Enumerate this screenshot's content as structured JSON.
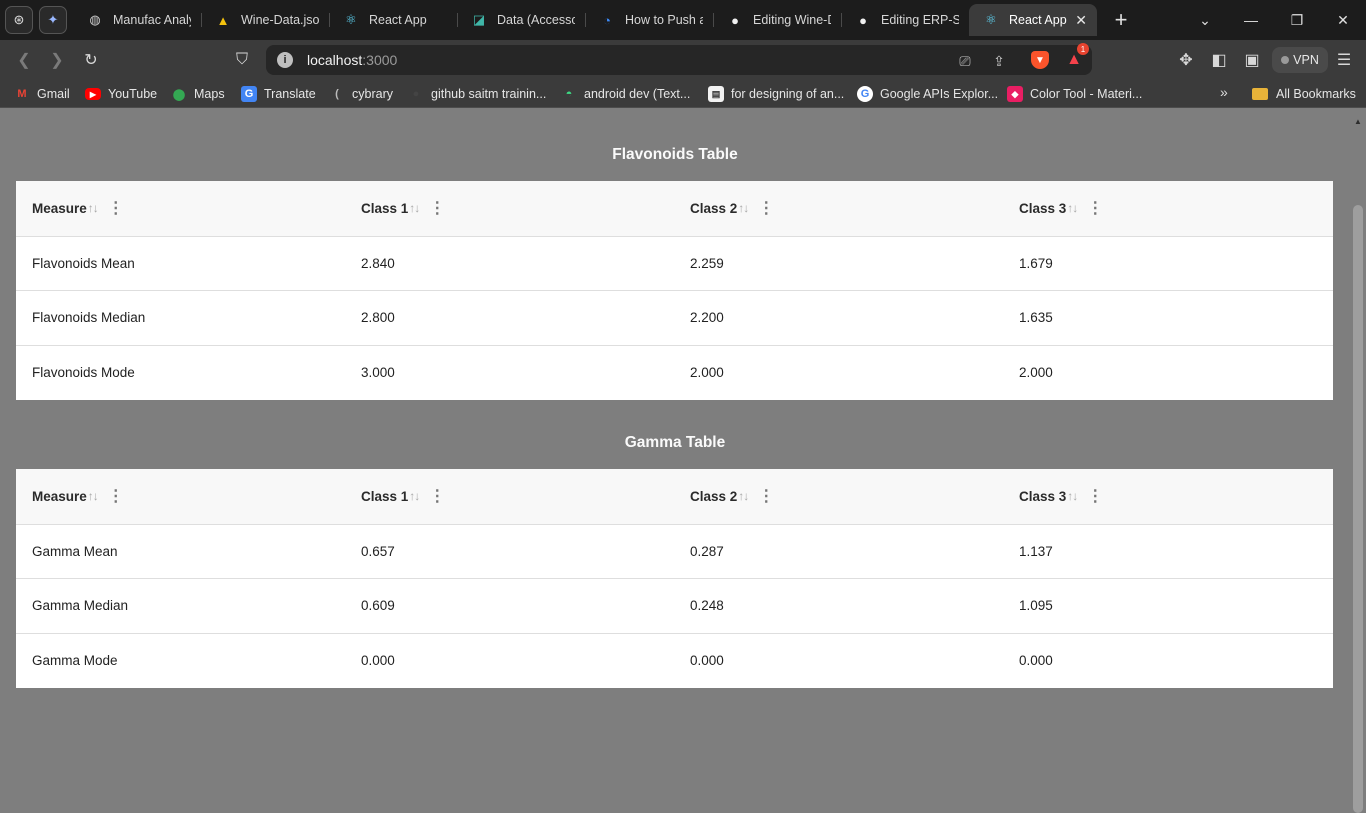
{
  "browser": {
    "pinned_tabs": [
      {
        "icon": "chatgpt-icon"
      },
      {
        "icon": "sparkle-icon"
      }
    ],
    "tabs": [
      {
        "title": "Manufac Analytics",
        "icon": "globe-icon"
      },
      {
        "title": "Wine-Data.json",
        "icon": "google-drive-icon"
      },
      {
        "title": "React App",
        "icon": "react-icon"
      },
      {
        "title": "Data (Accessories)",
        "icon": "bootstrap-icon"
      },
      {
        "title": "How to Push an",
        "icon": "question-icon"
      },
      {
        "title": "Editing Wine-Data",
        "icon": "github-icon"
      },
      {
        "title": "Editing ERP-System",
        "icon": "github-icon"
      },
      {
        "title": "React App",
        "icon": "react-icon",
        "active": true
      }
    ],
    "address": {
      "host": "localhost",
      "port": ":3000"
    },
    "rewards_badge": "1",
    "vpn_label": "VPN",
    "bookmarks": [
      {
        "label": "Gmail",
        "icon": "gmail-icon"
      },
      {
        "label": "YouTube",
        "icon": "youtube-icon"
      },
      {
        "label": "Maps",
        "icon": "maps-icon"
      },
      {
        "label": "Translate",
        "icon": "translate-icon"
      },
      {
        "label": "cybrary",
        "icon": "cybrary-icon"
      },
      {
        "label": "github saitm trainin...",
        "icon": "github-icon"
      },
      {
        "label": "android dev   (Text...",
        "icon": "android-icon"
      },
      {
        "label": "for designing of an...",
        "icon": "page-icon"
      },
      {
        "label": "Google APIs Explor...",
        "icon": "google-icon"
      },
      {
        "label": "Color Tool - Materi...",
        "icon": "material-icon"
      }
    ],
    "all_bookmarks_label": "All Bookmarks",
    "colors": {
      "tabstrip": "#1c1c1c",
      "toolbar": "#3b3b3b",
      "page_backdrop": "#7e7e7e"
    }
  },
  "page": {
    "tables": [
      {
        "title": "Flavonoids Table",
        "columns": [
          "Measure",
          "Class 1",
          "Class 2",
          "Class 3"
        ],
        "rows": [
          [
            "Flavonoids Mean",
            "2.840",
            "2.259",
            "1.679"
          ],
          [
            "Flavonoids Median",
            "2.800",
            "2.200",
            "1.635"
          ],
          [
            "Flavonoids Mode",
            "3.000",
            "2.000",
            "2.000"
          ]
        ]
      },
      {
        "title": "Gamma Table",
        "columns": [
          "Measure",
          "Class 1",
          "Class 2",
          "Class 3"
        ],
        "rows": [
          [
            "Gamma Mean",
            "0.657",
            "0.287",
            "1.137"
          ],
          [
            "Gamma Median",
            "0.609",
            "0.248",
            "1.095"
          ],
          [
            "Gamma Mode",
            "0.000",
            "0.000",
            "0.000"
          ]
        ]
      }
    ]
  }
}
